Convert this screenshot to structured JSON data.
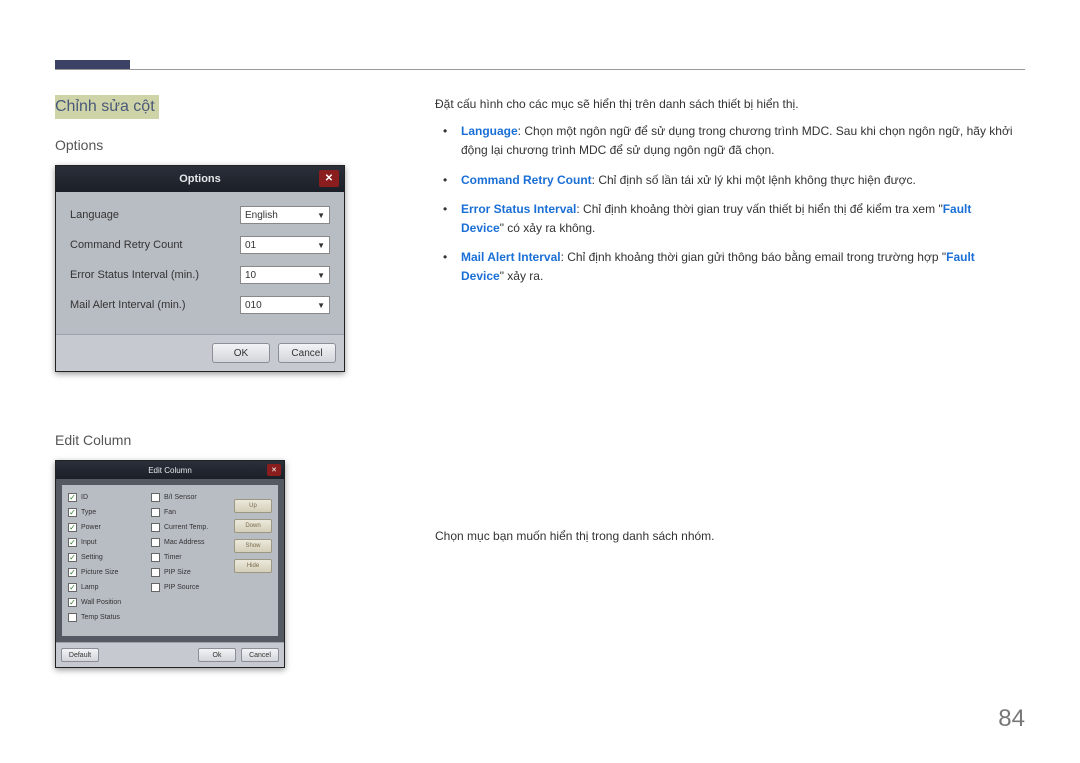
{
  "section_title": "Chỉnh sửa cột",
  "options_heading": "Options",
  "edit_column_heading": "Edit Column",
  "page_number": "84",
  "options_dialog": {
    "title": "Options",
    "rows": {
      "language_label": "Language",
      "language_value": "English",
      "retry_label": "Command Retry Count",
      "retry_value": "01",
      "errint_label": "Error Status Interval (min.)",
      "errint_value": "10",
      "mailint_label": "Mail Alert Interval (min.)",
      "mailint_value": "010"
    },
    "ok": "OK",
    "cancel": "Cancel"
  },
  "edit_dialog": {
    "title": "Edit Column",
    "col1": [
      "ID",
      "Type",
      "Power",
      "Input",
      "Setting",
      "Picture Size",
      "Lamp",
      "Wall Position",
      "Temp Status"
    ],
    "col1_checked": [
      true,
      true,
      true,
      true,
      true,
      true,
      true,
      true,
      false
    ],
    "col2": [
      "B/I Sensor",
      "Fan",
      "Current Temp.",
      "Mac Address",
      "Timer",
      "PIP Size",
      "PIP Source"
    ],
    "col2_checked": [
      false,
      false,
      false,
      false,
      false,
      false,
      false
    ],
    "side": [
      "Up",
      "Down",
      "Show",
      "Hide"
    ],
    "default": "Default",
    "ok": "Ok",
    "cancel": "Cancel"
  },
  "right": {
    "intro": "Đặt cấu hình cho các mục sẽ hiển thị trên danh sách thiết bị hiển thị.",
    "items": {
      "lang_key": "Language",
      "lang_text": ": Chọn một ngôn ngữ để sử dụng trong chương trình MDC. Sau khi chọn ngôn ngữ, hãy khởi động lại chương trình MDC để sử dụng ngôn ngữ đã chọn.",
      "retry_key": "Command Retry Count",
      "retry_text": ": Chỉ định số lần tái xử lý khi một lệnh không thực hiện được.",
      "errint_key": "Error Status Interval",
      "errint_text_a": ": Chỉ định khoảng thời gian truy vấn thiết bị hiển thị để kiểm tra xem \"",
      "errint_fault": "Fault Device",
      "errint_text_b": "\" có xảy ra không.",
      "mail_key": "Mail Alert Interval",
      "mail_text_a": ": Chỉ định khoảng thời gian gửi thông báo bằng email trong trường hợp \"",
      "mail_fault": "Fault Device",
      "mail_text_b": "\" xảy ra."
    },
    "edit_text": "Chọn mục bạn muốn hiển thị trong danh sách nhóm."
  }
}
